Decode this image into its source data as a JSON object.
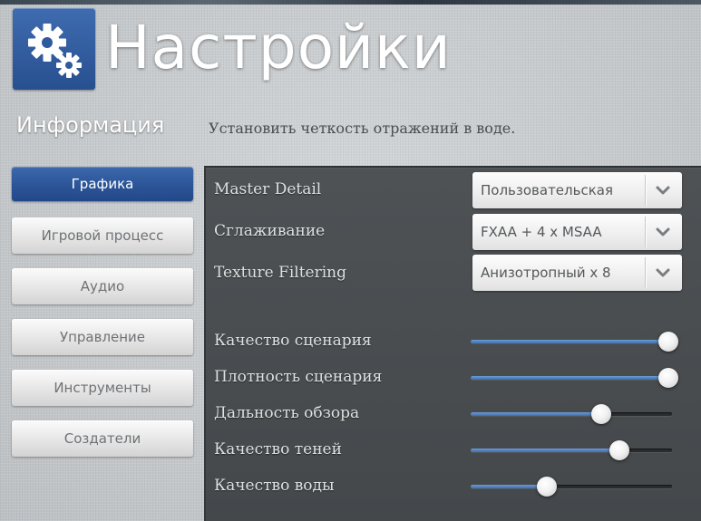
{
  "header": {
    "title": "Настройки",
    "logo_icon": "gears-icon",
    "accent_color": "#2e5a9e"
  },
  "sidebar": {
    "title": "Информация",
    "items": [
      {
        "label": "Графика",
        "active": true
      },
      {
        "label": "Игровой процесс",
        "active": false
      },
      {
        "label": "Аудио",
        "active": false
      },
      {
        "label": "Управление",
        "active": false
      },
      {
        "label": "Инструменты",
        "active": false
      },
      {
        "label": "Создатели",
        "active": false
      }
    ]
  },
  "hint": "Установить четкость отражений в воде.",
  "settings": {
    "dropdowns": [
      {
        "label": "Master Detail",
        "value": "Пользовательская"
      },
      {
        "label": "Сглаживание",
        "value": "FXAA + 4 x MSAA"
      },
      {
        "label": "Texture Filtering",
        "value": "Анизотропный х 8"
      }
    ],
    "sliders": [
      {
        "label": "Качество сценария",
        "value": 1.0
      },
      {
        "label": "Плотность сценария",
        "value": 1.0
      },
      {
        "label": "Дальность обзора",
        "value": 0.65
      },
      {
        "label": "Качество теней",
        "value": 0.74
      },
      {
        "label": "Качество воды",
        "value": 0.38
      }
    ]
  }
}
